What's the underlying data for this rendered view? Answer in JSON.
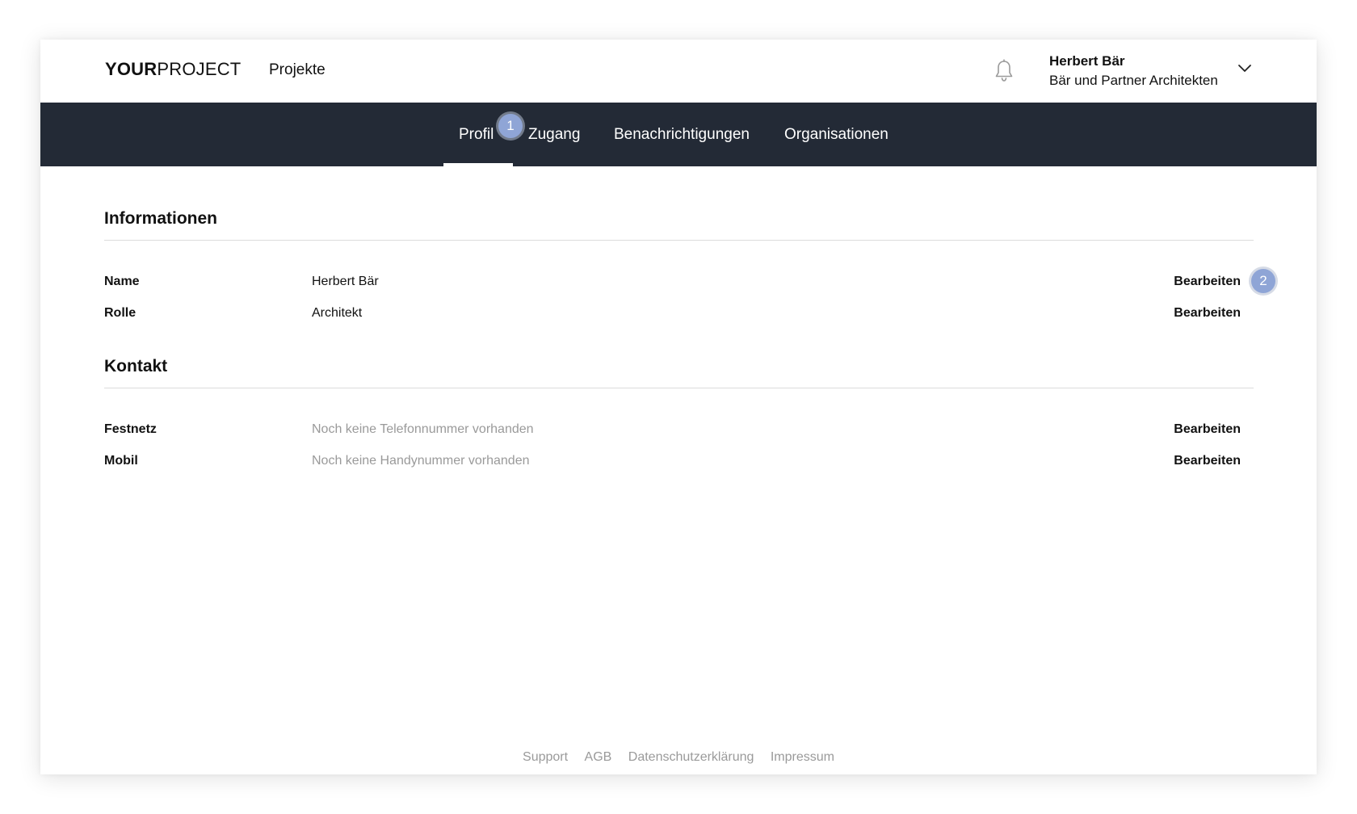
{
  "header": {
    "logo_bold": "YOUR",
    "logo_light": "PROJECT",
    "projects_label": "Projekte",
    "bell_icon": "bell-icon",
    "user_name": "Herbert Bär",
    "user_org": "Bär und Partner Architekten",
    "chevron_icon": "chevron-down-icon"
  },
  "tabs": [
    {
      "label": "Profil",
      "active": true
    },
    {
      "label": "Zugang",
      "active": false
    },
    {
      "label": "Benachrichtigungen",
      "active": false
    },
    {
      "label": "Organisationen",
      "active": false
    }
  ],
  "markers": [
    "1",
    "2"
  ],
  "sections": {
    "info": {
      "title": "Informationen",
      "rows": [
        {
          "label": "Name",
          "value": "Herbert Bär",
          "action": "Bearbeiten"
        },
        {
          "label": "Rolle",
          "value": "Architekt",
          "action": "Bearbeiten"
        }
      ]
    },
    "contact": {
      "title": "Kontakt",
      "rows": [
        {
          "label": "Festnetz",
          "value": "Noch keine Telefonnummer vorhanden",
          "action": "Bearbeiten"
        },
        {
          "label": "Mobil",
          "value": "Noch keine Handynummer vorhanden",
          "action": "Bearbeiten"
        }
      ]
    }
  },
  "footer": {
    "links": [
      "Support",
      "AGB",
      "Datenschutzerklärung",
      "Impressum"
    ]
  },
  "colors": {
    "tabbar_bg": "#232a36",
    "marker": "#8fa5d6",
    "muted_text": "#9a9a9a"
  }
}
